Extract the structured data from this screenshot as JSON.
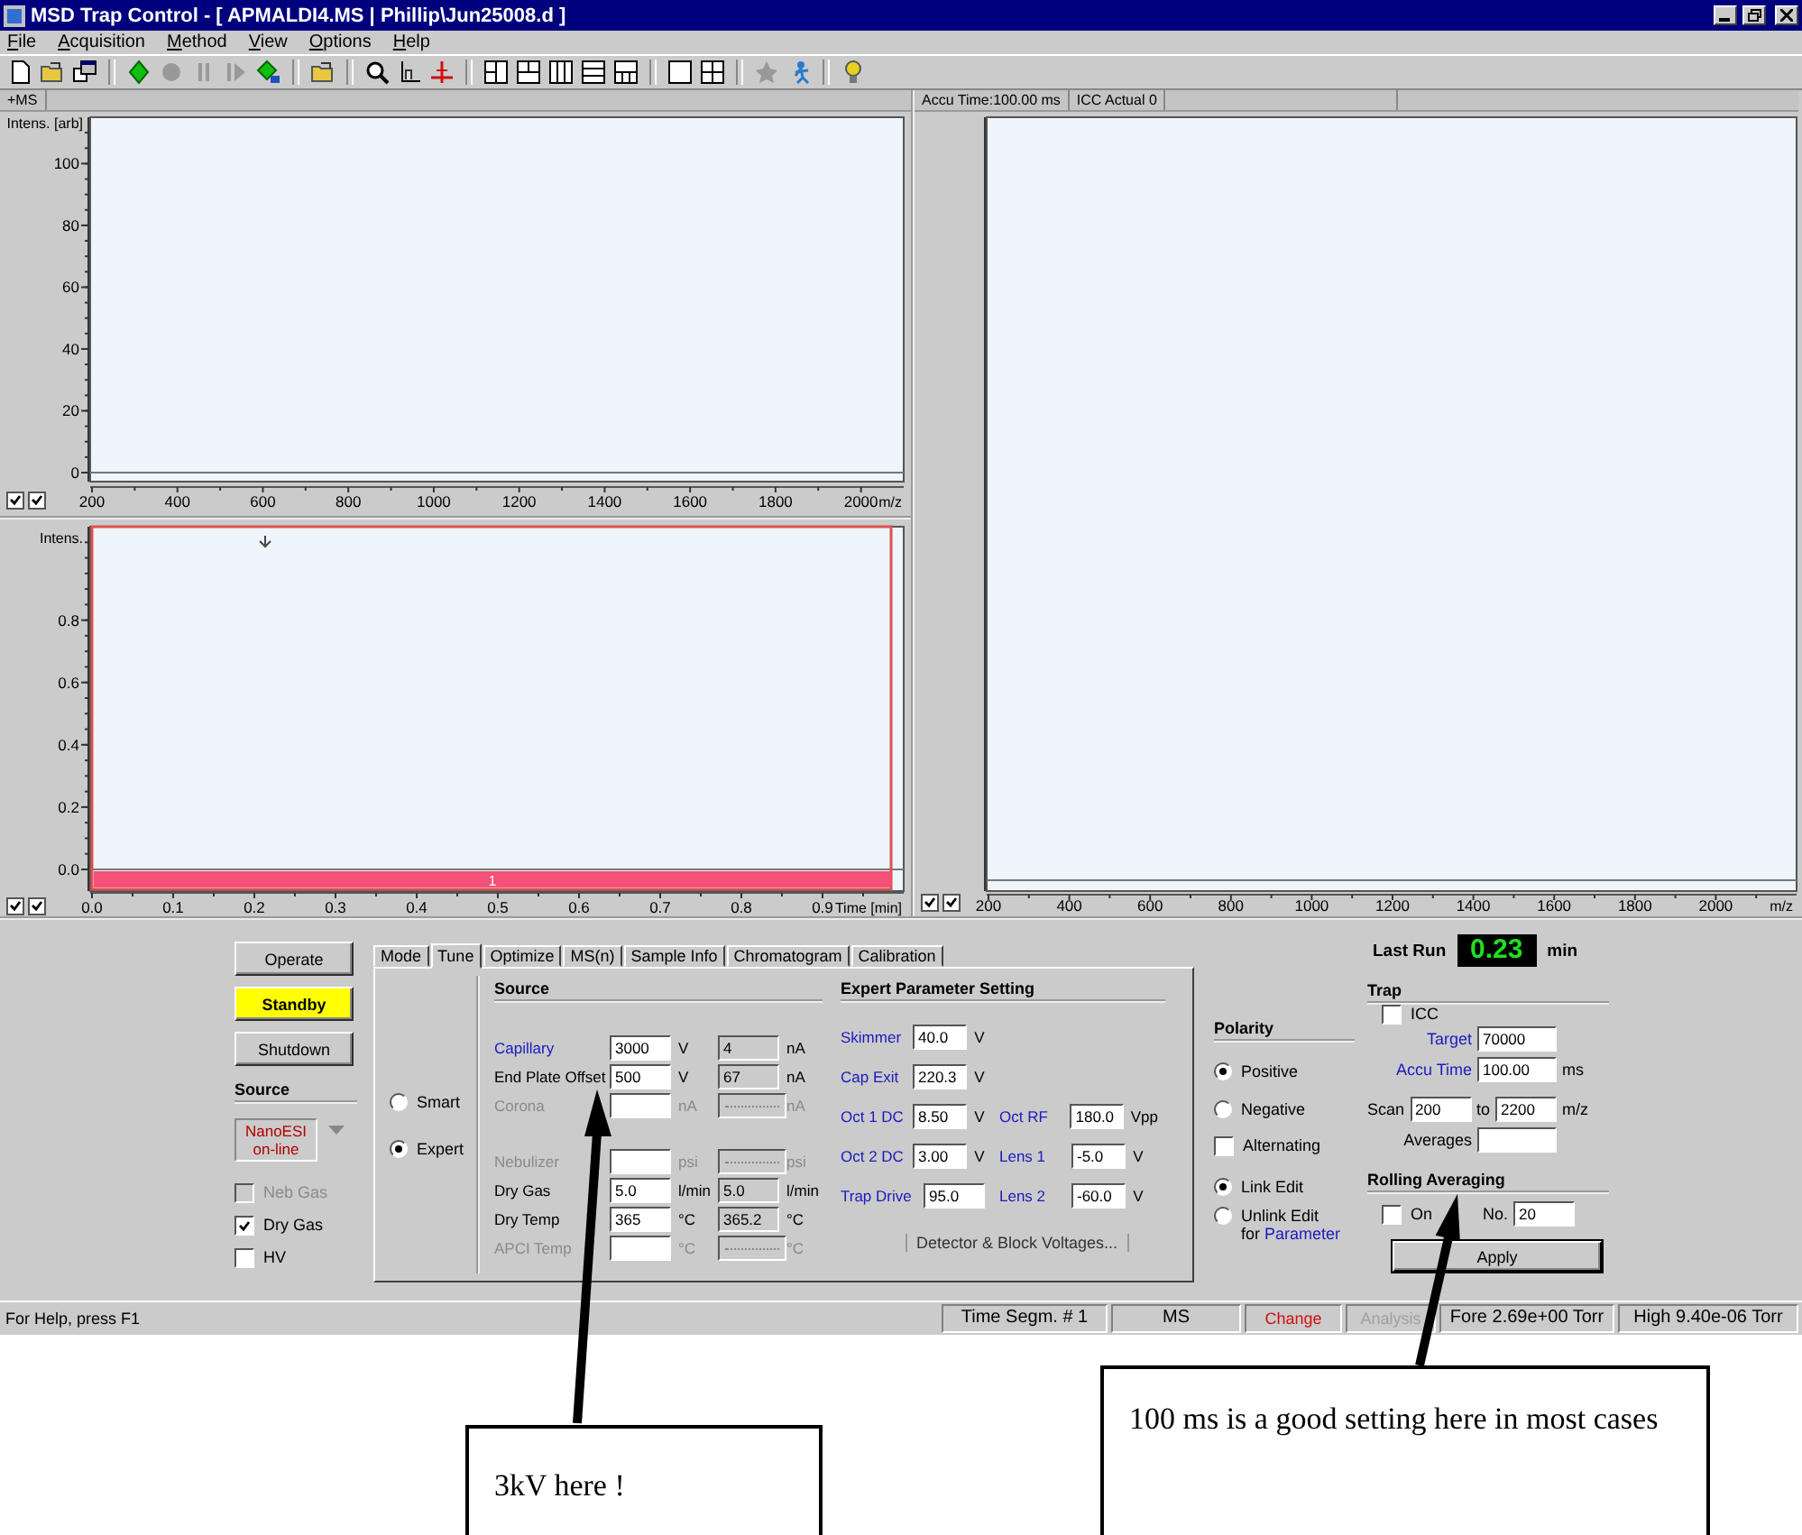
{
  "window": {
    "title": "MSD Trap Control - [ APMALDI4.MS | Phillip\\Jun25008.d ]"
  },
  "menu": [
    "File",
    "Acquisition",
    "Method",
    "View",
    "Options",
    "Help"
  ],
  "spectrum_pane": {
    "header": "+MS",
    "checkboxes": [
      {
        "checked": true
      },
      {
        "checked": true
      }
    ],
    "chart_data": {
      "type": "line",
      "xlabel": "m/z",
      "ylabel": "Intens. [arb]",
      "xlim": [
        200,
        2100
      ],
      "ylim": [
        0,
        115
      ],
      "xticks": [
        200,
        400,
        600,
        800,
        1000,
        1200,
        1400,
        1600,
        1800,
        2000
      ],
      "yticks": [
        0,
        20,
        40,
        60,
        80,
        100
      ]
    }
  },
  "chromatogram_pane": {
    "segment_label": "1",
    "checkboxes": [
      {
        "checked": true
      },
      {
        "checked": true
      }
    ],
    "chart_data": {
      "type": "line",
      "xlabel": "Time [min]",
      "ylabel": "Intens.",
      "xlim": [
        0,
        1.0
      ],
      "ylim": [
        0,
        1.1
      ],
      "xticks": [
        {
          "value": 0,
          "label": "0.0"
        },
        {
          "value": 0.1,
          "label": "0.1"
        },
        {
          "value": 0.2,
          "label": "0.2"
        },
        {
          "value": 0.3,
          "label": "0.3"
        },
        {
          "value": 0.4,
          "label": "0.4"
        },
        {
          "value": 0.5,
          "label": "0.5"
        },
        {
          "value": 0.6,
          "label": "0.6"
        },
        {
          "value": 0.7,
          "label": "0.7"
        },
        {
          "value": 0.8,
          "label": "0.8"
        },
        {
          "value": 0.9,
          "label": "0.9"
        }
      ],
      "yticks": [
        {
          "value": 0,
          "label": "0.0"
        },
        {
          "value": 0.2,
          "label": "0.2"
        },
        {
          "value": 0.4,
          "label": "0.4"
        },
        {
          "value": 0.6,
          "label": "0.6"
        },
        {
          "value": 0.8,
          "label": "0.8"
        }
      ]
    }
  },
  "scan_pane": {
    "header": [
      "Accu Time:100.00 ms",
      "ICC Actual 0"
    ],
    "checkboxes": [
      {
        "checked": true
      },
      {
        "checked": true
      }
    ],
    "x_axis_labels": [
      "200",
      "400",
      "600",
      "800",
      "1000",
      "1200",
      "1400",
      "1600",
      "1800",
      "2000"
    ],
    "x_axis_title": "m/z"
  },
  "control_buttons": [
    {
      "label": "Operate",
      "active": false
    },
    {
      "label": "Standby",
      "active": true
    },
    {
      "label": "Shutdown",
      "active": false
    }
  ],
  "source": {
    "heading": "Source",
    "device": "NanoESI on-line",
    "options": [
      {
        "label": "Neb Gas",
        "checked": false,
        "disabled": true
      },
      {
        "label": "Dry Gas",
        "checked": true,
        "disabled": false
      },
      {
        "label": "HV",
        "checked": false,
        "disabled": false
      }
    ]
  },
  "tabs": [
    {
      "label": "Mode",
      "selected": false
    },
    {
      "label": "Tune",
      "selected": true
    },
    {
      "label": "Optimize",
      "selected": false
    },
    {
      "label": "MS(n)",
      "selected": false
    },
    {
      "label": "Sample Info",
      "selected": false
    },
    {
      "label": "Chromatogram",
      "selected": false
    },
    {
      "label": "Calibration",
      "selected": false
    }
  ],
  "tune_mode": [
    {
      "label": "Smart",
      "selected": false
    },
    {
      "label": "Expert",
      "selected": true
    }
  ],
  "source_settings": {
    "heading": "Source",
    "row_groups": [
      [
        {
          "label": "Capillary",
          "kind": "link",
          "disabled": false,
          "value": "3000",
          "unit": "V",
          "reading": "4",
          "reading_unit": "nA"
        },
        {
          "label": "End Plate Offset",
          "kind": "plain",
          "disabled": false,
          "value": "500",
          "unit": "V",
          "reading": "67",
          "reading_unit": "nA"
        },
        {
          "label": "Corona",
          "kind": "plain",
          "disabled": true,
          "unit": "nA",
          "reading_unit": "nA"
        }
      ],
      [
        {
          "label": "Nebulizer",
          "kind": "plain",
          "disabled": true,
          "unit": "psi",
          "reading_unit": "psi"
        },
        {
          "label": "Dry Gas",
          "kind": "plain",
          "disabled": false,
          "value": "5.0",
          "unit": "l/min",
          "reading": "5.0",
          "reading_unit": "l/min"
        },
        {
          "label": "Dry Temp",
          "kind": "plain",
          "disabled": false,
          "value": "365",
          "unit": "°C",
          "reading": "365.2",
          "reading_unit": "°C"
        },
        {
          "label": "APCI Temp",
          "kind": "plain",
          "disabled": true,
          "unit": "°C",
          "reading_unit": "°C"
        }
      ]
    ]
  },
  "expert_settings": {
    "heading": "Expert Parameter Setting",
    "rows": [
      [
        {
          "label": "Skimmer",
          "value": "40.0",
          "unit": "V"
        }
      ],
      [
        {
          "label": "Cap Exit",
          "value": "220.3",
          "unit": "V"
        }
      ],
      [
        {
          "label": "Oct 1 DC",
          "value": "8.50",
          "unit": "V"
        },
        {
          "label": "Oct RF",
          "value": "180.0",
          "unit": "Vpp"
        }
      ],
      [
        {
          "label": "Oct 2 DC",
          "value": "3.00",
          "unit": "V"
        },
        {
          "label": "Lens 1",
          "value": "-5.0",
          "unit": "V"
        }
      ],
      [
        {
          "label": "Trap Drive",
          "value": "95.0"
        },
        {
          "label": "Lens 2",
          "value": "-60.0",
          "unit": "V"
        }
      ]
    ],
    "button": "Detector & Block Voltages..."
  },
  "polarity": {
    "heading": "Polarity",
    "options": [
      {
        "label": "Positive",
        "selected": true
      },
      {
        "label": "Negative",
        "selected": false
      }
    ],
    "alternating": {
      "label": "Alternating",
      "checked": false
    },
    "edit_modes": [
      {
        "label": "Link Edit",
        "selected": true
      },
      {
        "label": "Unlink Edit",
        "selected": false,
        "note": "for",
        "link": "Parameter"
      }
    ]
  },
  "last_run": {
    "label": "Last Run",
    "value": "0.23",
    "unit": "min"
  },
  "trap": {
    "heading": "Trap",
    "icc": {
      "label": "ICC",
      "checked": false
    },
    "target": {
      "label": "Target",
      "value": "70000"
    },
    "accu_time": {
      "label": "Accu Time",
      "value": "100.00",
      "unit": "ms"
    },
    "scan": {
      "label": "Scan",
      "from": "200",
      "joiner": "to",
      "to": "2200",
      "unit": "m/z"
    },
    "averages": {
      "label": "Averages"
    }
  },
  "rolling_averaging": {
    "heading": "Rolling Averaging",
    "on": {
      "label": "On",
      "checked": false
    },
    "number": {
      "label": "No.",
      "value": "20"
    }
  },
  "apply_button": "Apply",
  "status_bar": {
    "help": "For Help, press F1",
    "panes": [
      {
        "text": "Time Segm. # 1",
        "kind": "normal"
      },
      {
        "text": "MS",
        "kind": "normal"
      },
      {
        "text": "Change",
        "kind": "warning"
      },
      {
        "text": "Analysis",
        "kind": "disabled"
      },
      {
        "text": "Fore 2.69e+00 Torr",
        "kind": "normal"
      },
      {
        "text": "High 9.40e-06 Torr",
        "kind": "normal"
      }
    ]
  },
  "annotations": [
    {
      "text": "3kV here !"
    },
    {
      "text": "100 ms is a good setting here in most cases"
    }
  ]
}
